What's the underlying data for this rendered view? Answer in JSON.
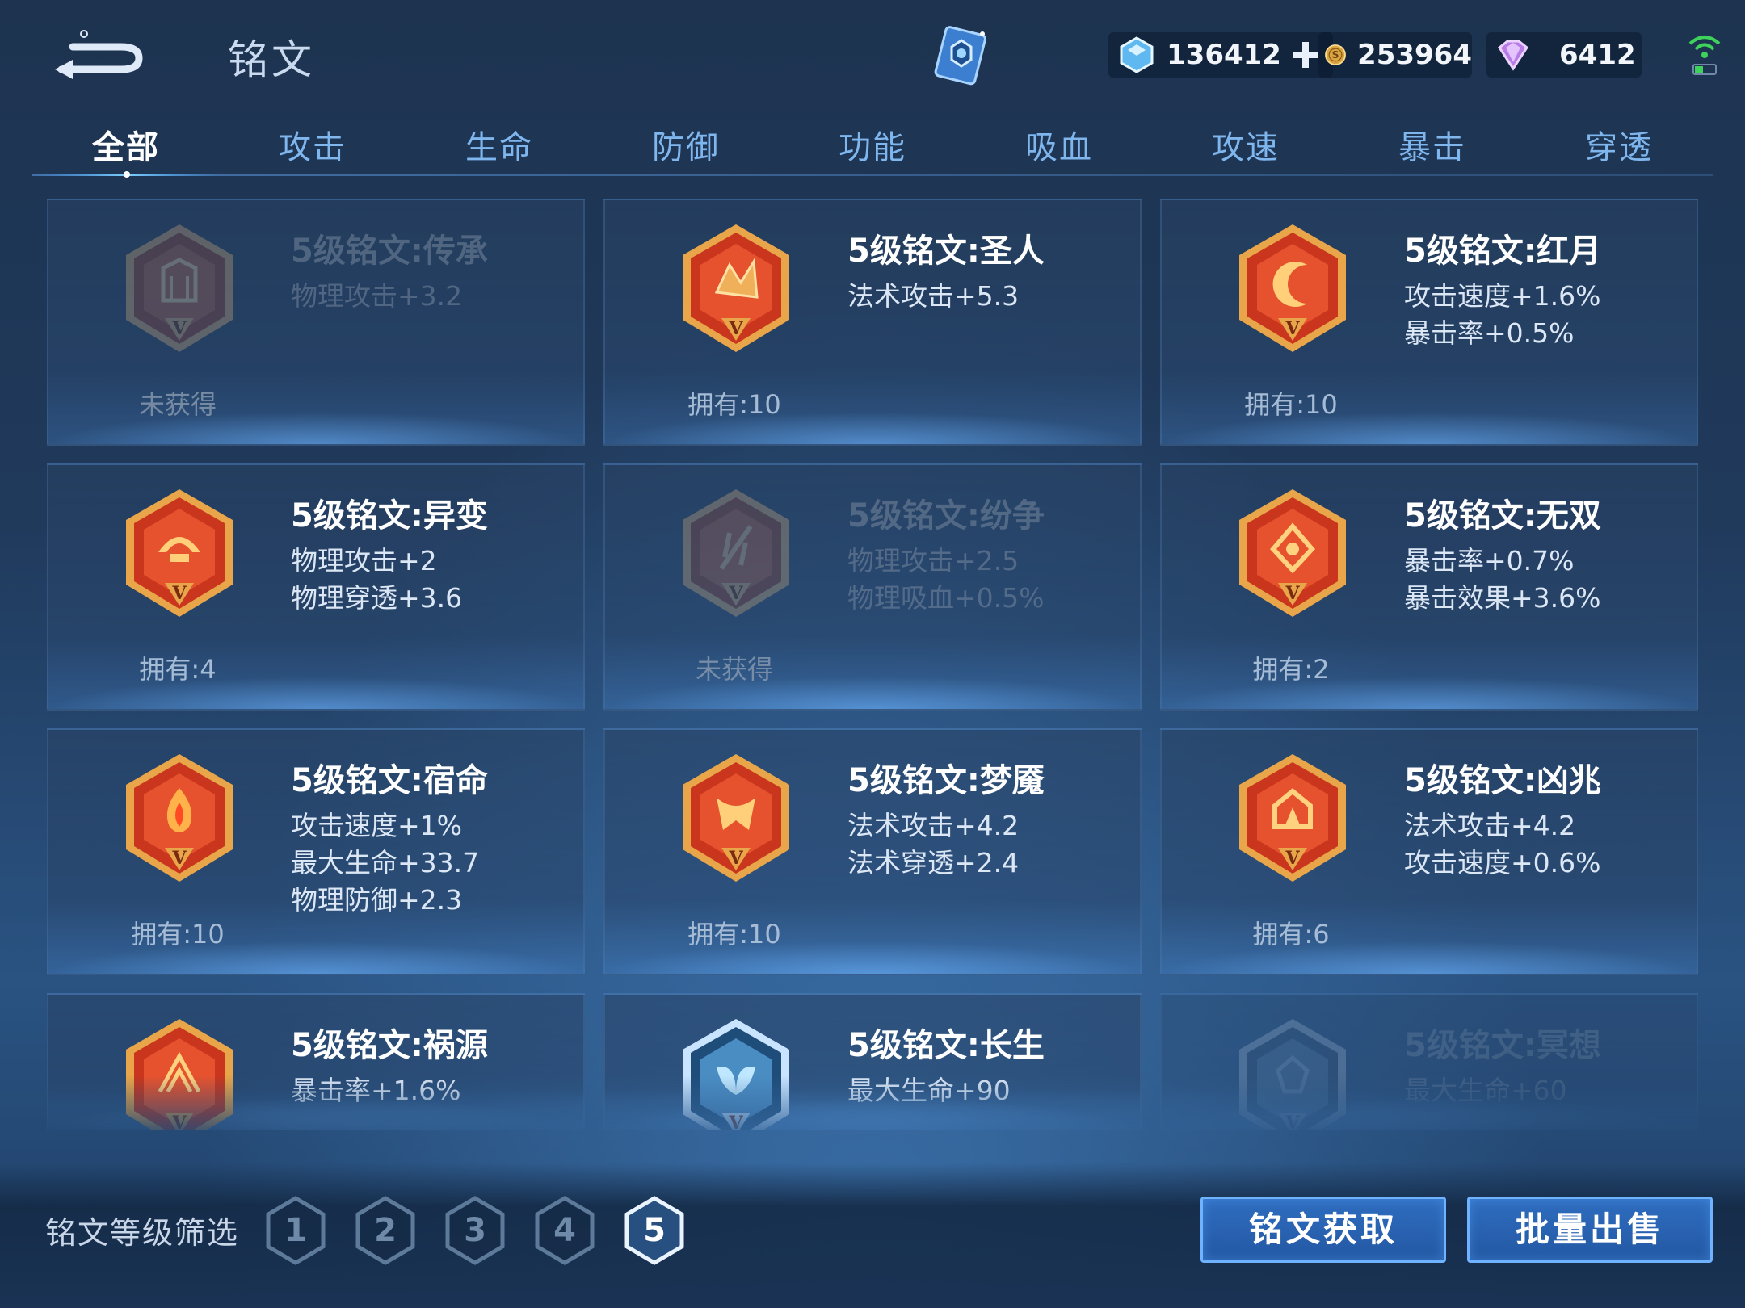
{
  "header": {
    "title": "铭文",
    "back_icon": "back-arrow-icon",
    "gems": "136412",
    "coins": "253964",
    "diamonds": "6412"
  },
  "tabs": [
    {
      "label": "全部",
      "active": true
    },
    {
      "label": "攻击"
    },
    {
      "label": "生命"
    },
    {
      "label": "防御"
    },
    {
      "label": "功能"
    },
    {
      "label": "吸血"
    },
    {
      "label": "攻速"
    },
    {
      "label": "暴击"
    },
    {
      "label": "穿透"
    }
  ],
  "runes": [
    {
      "name": "5级铭文:传承",
      "stats": [
        "物理攻击+3.2"
      ],
      "owned": "未获得",
      "locked": true,
      "icon": "rune-chuancheng-icon"
    },
    {
      "name": "5级铭文:圣人",
      "stats": [
        "法术攻击+5.3"
      ],
      "owned": "拥有:10",
      "icon": "rune-shengren-icon"
    },
    {
      "name": "5级铭文:红月",
      "stats": [
        "攻击速度+1.6%",
        "暴击率+0.5%"
      ],
      "owned": "拥有:10",
      "icon": "rune-hongyue-icon"
    },
    {
      "name": "5级铭文:异变",
      "stats": [
        "物理攻击+2",
        "物理穿透+3.6"
      ],
      "owned": "拥有:4",
      "icon": "rune-yibian-icon"
    },
    {
      "name": "5级铭文:纷争",
      "stats": [
        "物理攻击+2.5",
        "物理吸血+0.5%"
      ],
      "owned": "未获得",
      "locked": true,
      "icon": "rune-fenzheng-icon"
    },
    {
      "name": "5级铭文:无双",
      "stats": [
        "暴击率+0.7%",
        "暴击效果+3.6%"
      ],
      "owned": "拥有:2",
      "icon": "rune-wushuang-icon"
    },
    {
      "name": "5级铭文:宿命",
      "stats": [
        "攻击速度+1%",
        "最大生命+33.7",
        "物理防御+2.3"
      ],
      "owned": "拥有:10",
      "icon": "rune-suming-icon"
    },
    {
      "name": "5级铭文:梦魇",
      "stats": [
        "法术攻击+4.2",
        "法术穿透+2.4"
      ],
      "owned": "拥有:10",
      "icon": "rune-mengyan-icon"
    },
    {
      "name": "5级铭文:凶兆",
      "stats": [
        "法术攻击+4.2",
        "攻击速度+0.6%"
      ],
      "owned": "拥有:6",
      "icon": "rune-xiongzhao-icon"
    },
    {
      "name": "5级铭文:祸源",
      "stats": [
        "暴击率+1.6%"
      ],
      "owned": "",
      "icon": "rune-huoyuan-icon"
    },
    {
      "name": "5级铭文:长生",
      "stats": [
        "最大生命+90"
      ],
      "owned": "",
      "blue": true,
      "icon": "rune-changsheng-icon"
    },
    {
      "name": "5级铭文:冥想",
      "stats": [
        "最大生命+60"
      ],
      "owned": "",
      "locked": true,
      "blue": true,
      "icon": "rune-mingxiang-icon"
    }
  ],
  "filter": {
    "label": "铭文等级筛选",
    "levels": [
      "1",
      "2",
      "3",
      "4",
      "5"
    ],
    "selected": "5"
  },
  "buttons": {
    "obtain": "铭文获取",
    "sell": "批量出售"
  },
  "colors": {
    "accent_blue": "#2f6dc0",
    "rune_red": "#c9361d",
    "rune_gold": "#e8a54a",
    "tab_inactive": "#7fb6ee"
  }
}
